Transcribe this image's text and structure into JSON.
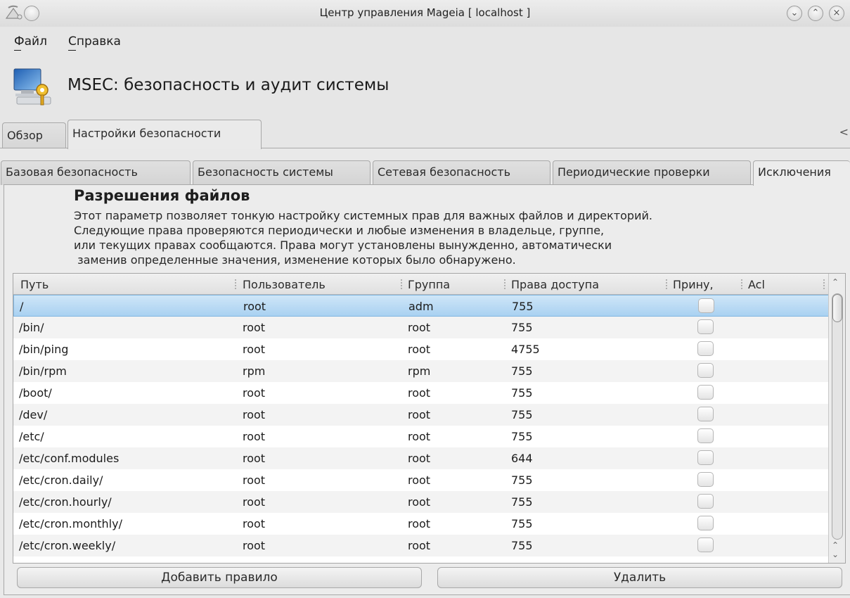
{
  "window": {
    "title": "Центр управления Mageia  [ localhost ]",
    "buttons": [
      "minimize",
      "maximize",
      "close"
    ]
  },
  "menu": {
    "items": [
      {
        "label": "Файл"
      },
      {
        "label": "Справка"
      }
    ]
  },
  "header": {
    "title": "MSEC: безопасность и аудит системы",
    "icon": "msec-computer-key-icon"
  },
  "main_tabs": [
    {
      "label": "Обзор"
    },
    {
      "label": "Настройки безопасности",
      "active": true
    }
  ],
  "tab_scroll_glyph": "<",
  "sub_tabs": [
    {
      "label": "Базовая безопасность"
    },
    {
      "label": "Безопасность системы"
    },
    {
      "label": "Сетевая безопасность"
    },
    {
      "label": "Периодические проверки"
    },
    {
      "label": "Исключения"
    }
  ],
  "section": {
    "title": "Разрешения файлов",
    "description": [
      "Этот параметр позволяет тонкую настройку системных прав для важных файлов и директорий.",
      "Следующие права проверяются периодически и любые изменения в владельце, группе,",
      "или текущих правах сообщаются. Права могут установлены вынужденно, автоматически",
      " заменив определенные значения, изменение которых было обнаружено."
    ]
  },
  "table": {
    "columns": [
      "Путь",
      "Пользователь",
      "Группа",
      "Права доступа",
      "Прину,",
      "Acl"
    ],
    "rows": [
      {
        "path": "/",
        "user": "root",
        "group": "adm",
        "perm": "755",
        "forced": false,
        "selected": true
      },
      {
        "path": "/bin/",
        "user": "root",
        "group": "root",
        "perm": "755",
        "forced": false
      },
      {
        "path": "/bin/ping",
        "user": "root",
        "group": "root",
        "perm": "4755",
        "forced": false
      },
      {
        "path": "/bin/rpm",
        "user": "rpm",
        "group": "rpm",
        "perm": "755",
        "forced": false
      },
      {
        "path": "/boot/",
        "user": "root",
        "group": "root",
        "perm": "755",
        "forced": false
      },
      {
        "path": "/dev/",
        "user": "root",
        "group": "root",
        "perm": "755",
        "forced": false
      },
      {
        "path": "/etc/",
        "user": "root",
        "group": "root",
        "perm": "755",
        "forced": false
      },
      {
        "path": "/etc/conf.modules",
        "user": "root",
        "group": "root",
        "perm": "644",
        "forced": false
      },
      {
        "path": "/etc/cron.daily/",
        "user": "root",
        "group": "root",
        "perm": "755",
        "forced": false
      },
      {
        "path": "/etc/cron.hourly/",
        "user": "root",
        "group": "root",
        "perm": "755",
        "forced": false
      },
      {
        "path": "/etc/cron.monthly/",
        "user": "root",
        "group": "root",
        "perm": "755",
        "forced": false
      },
      {
        "path": "/etc/cron.weekly/",
        "user": "root",
        "group": "root",
        "perm": "755",
        "forced": false
      }
    ]
  },
  "buttons": {
    "add": "Добавить правило",
    "delete": "Удалить"
  }
}
